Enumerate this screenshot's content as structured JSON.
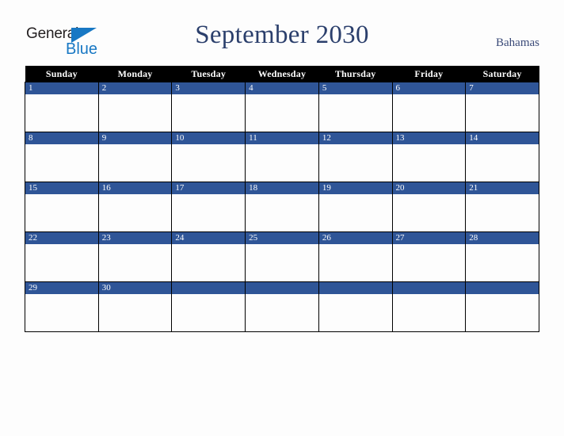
{
  "brand": {
    "name_part1": "General",
    "name_part2": "Blue",
    "triangle_icon": "triangle-icon",
    "color_dark": "#231f20",
    "color_blue": "#1878c4"
  },
  "header": {
    "title": "September 2030",
    "month": "September",
    "year": "2030",
    "country": "Bahamas",
    "title_color": "#2b3f6c",
    "country_color": "#3a4a78"
  },
  "calendar": {
    "weekday_headers": [
      "Sunday",
      "Monday",
      "Tuesday",
      "Wednesday",
      "Thursday",
      "Friday",
      "Saturday"
    ],
    "header_bg": "#000000",
    "header_text": "#ffffff",
    "day_band_bg": "#2f5597",
    "day_number_color": "#ffffff",
    "cell_bg": "#fdfdfd",
    "grid_line": "#000000",
    "weeks": [
      {
        "days": [
          {
            "number": "1",
            "events": ""
          },
          {
            "number": "2",
            "events": ""
          },
          {
            "number": "3",
            "events": ""
          },
          {
            "number": "4",
            "events": ""
          },
          {
            "number": "5",
            "events": ""
          },
          {
            "number": "6",
            "events": ""
          },
          {
            "number": "7",
            "events": ""
          }
        ]
      },
      {
        "days": [
          {
            "number": "8",
            "events": ""
          },
          {
            "number": "9",
            "events": ""
          },
          {
            "number": "10",
            "events": ""
          },
          {
            "number": "11",
            "events": ""
          },
          {
            "number": "12",
            "events": ""
          },
          {
            "number": "13",
            "events": ""
          },
          {
            "number": "14",
            "events": ""
          }
        ]
      },
      {
        "days": [
          {
            "number": "15",
            "events": ""
          },
          {
            "number": "16",
            "events": ""
          },
          {
            "number": "17",
            "events": ""
          },
          {
            "number": "18",
            "events": ""
          },
          {
            "number": "19",
            "events": ""
          },
          {
            "number": "20",
            "events": ""
          },
          {
            "number": "21",
            "events": ""
          }
        ]
      },
      {
        "days": [
          {
            "number": "22",
            "events": ""
          },
          {
            "number": "23",
            "events": ""
          },
          {
            "number": "24",
            "events": ""
          },
          {
            "number": "25",
            "events": ""
          },
          {
            "number": "26",
            "events": ""
          },
          {
            "number": "27",
            "events": ""
          },
          {
            "number": "28",
            "events": ""
          }
        ]
      },
      {
        "days": [
          {
            "number": "29",
            "events": ""
          },
          {
            "number": "30",
            "events": ""
          },
          {
            "number": "",
            "events": ""
          },
          {
            "number": "",
            "events": ""
          },
          {
            "number": "",
            "events": ""
          },
          {
            "number": "",
            "events": ""
          },
          {
            "number": "",
            "events": ""
          }
        ]
      }
    ]
  }
}
